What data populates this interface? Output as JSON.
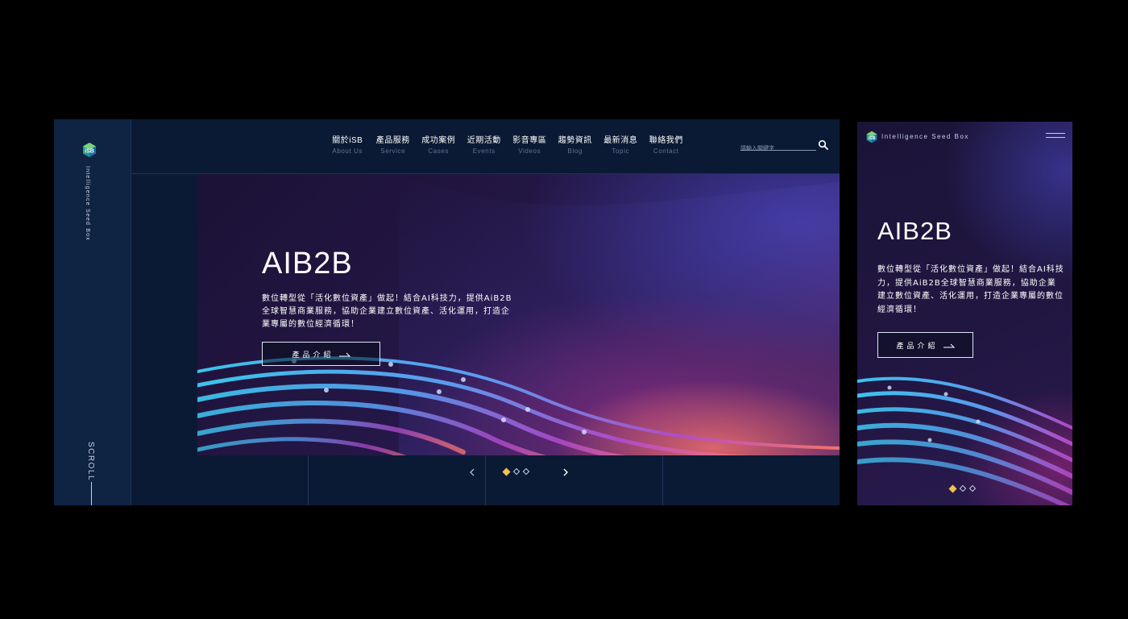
{
  "brand": {
    "logo_text": "iSB",
    "name": "Intelligence Seed Box"
  },
  "nav": [
    {
      "zh": "關於iSB",
      "en": "About Us"
    },
    {
      "zh": "產品服務",
      "en": "Service"
    },
    {
      "zh": "成功案例",
      "en": "Cases"
    },
    {
      "zh": "近期活動",
      "en": "Events"
    },
    {
      "zh": "影音專區",
      "en": "Videos"
    },
    {
      "zh": "趨勢資訊",
      "en": "Blog"
    },
    {
      "zh": "最新消息",
      "en": "Topic"
    },
    {
      "zh": "聯絡我們",
      "en": "Contact"
    }
  ],
  "search": {
    "placeholder": "請輸入關鍵字",
    "icon": "search-icon"
  },
  "hero": {
    "title": "AIB2B",
    "desktop_description": "數位轉型從「活化數位資產」做起！結合AI科技力，提供AiB2B全球智慧商業服務，協助企業建立數位資產、活化運用，打造企業專屬的數位經濟循環！",
    "mobile_description": "數位轉型從「活化數位資產」做起！結合AI科技力，提供AiB2B全球智慧商業服務，協助企業建立數位資產、活化運用，打造企業專屬的數位經濟循環！",
    "cta_label": "產品介紹"
  },
  "sidebar": {
    "scroll_label": "SCROLL"
  },
  "pager": {
    "prev_icon": "chevron-left-icon",
    "next_icon": "chevron-right-icon",
    "slides": 3,
    "active_slide": 1
  },
  "colors": {
    "accent": "#f2c14e",
    "page_bg": "#0b1a34",
    "sidebar_bg": "#0f2343"
  }
}
